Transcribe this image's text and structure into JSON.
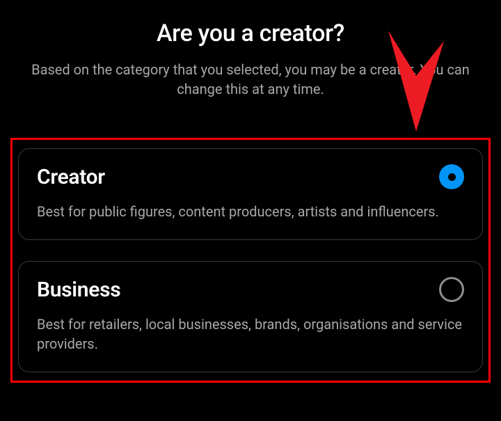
{
  "header": {
    "title": "Are you a creator?",
    "subtitle": "Based on the category that you selected, you may be a creator. You can change this at any time."
  },
  "options": [
    {
      "title": "Creator",
      "description": "Best for public figures, content producers, artists and influencers.",
      "selected": true
    },
    {
      "title": "Business",
      "description": "Best for retailers, local businesses, brands, organisations and service providers.",
      "selected": false
    }
  ],
  "annotation": {
    "highlight_color": "#ff0000"
  }
}
